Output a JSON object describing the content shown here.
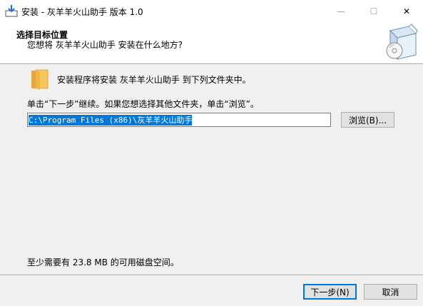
{
  "window": {
    "title": "安装 - 灰羊羊火山助手 版本 1.0",
    "controls": {
      "minimize": "—",
      "maximize": "☐",
      "close": "✕"
    }
  },
  "header": {
    "title": "选择目标位置",
    "subtitle": "您想将 灰羊羊火山助手 安装在什么地方?"
  },
  "body": {
    "intro": "安装程序将安装 灰羊羊火山助手 到下列文件夹中。",
    "instruction": "单击“下一步”继续。如果您想选择其他文件夹，单击“浏览”。",
    "path_value": "C:\\Program Files (x86)\\灰羊羊火山助手",
    "browse_label": "浏览(B)...",
    "space_required": "至少需要有 23.8 MB 的可用磁盘空间。"
  },
  "footer": {
    "next_label": "下一步(N)",
    "cancel_label": "取消"
  }
}
